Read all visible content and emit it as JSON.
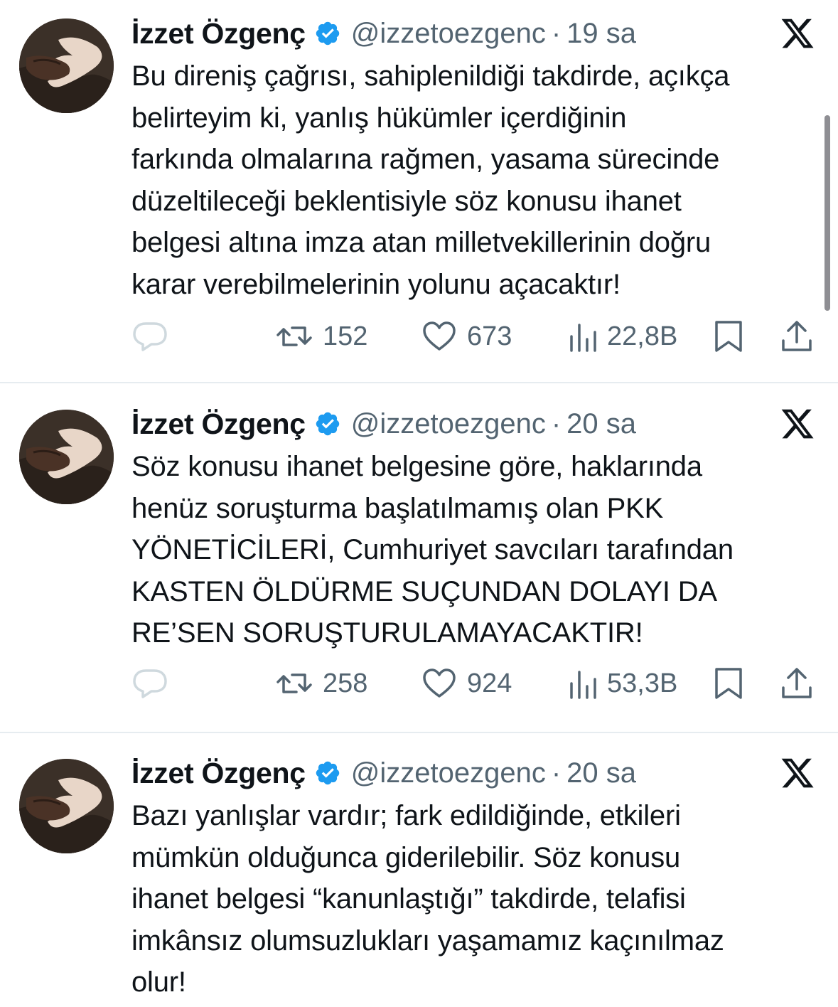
{
  "tweets": [
    {
      "name": "İzzet Özgenç",
      "handle": "@izzetoezgenc",
      "separator": "·",
      "time": "19 sa",
      "lines": [
        "Bu direniş çağrısı, sahiplenildiği takdirde, açıkça",
        "belirteyim ki, yanlış hükümler içerdiğinin",
        "farkında olmalarına rağmen, yasama sürecinde",
        "düzeltileceği beklentisiyle söz konusu ihanet",
        "belgesi altına imza atan milletvekillerinin doğru",
        "karar verebilmelerinin yolunu açacaktır!"
      ],
      "retweets": "152",
      "likes": "673",
      "views": "22,8B"
    },
    {
      "name": "İzzet Özgenç",
      "handle": "@izzetoezgenc",
      "separator": "·",
      "time": "20 sa",
      "lines": [
        "Söz konusu ihanet belgesine göre, haklarında",
        "henüz soruşturma başlatılmamış olan PKK",
        "YÖNETİCİLERİ, Cumhuriyet savcıları tarafından",
        "KASTEN ÖLDÜRME SUÇUNDAN DOLAYI DA",
        "RE’SEN SORUŞTURULAMAYACAKTIR!"
      ],
      "retweets": "258",
      "likes": "924",
      "views": "53,3B"
    },
    {
      "name": "İzzet Özgenç",
      "handle": "@izzetoezgenc",
      "separator": "·",
      "time": "20 sa",
      "lines": [
        "Bazı yanlışlar vardır; fark edildiğinde, etkileri",
        "mümkün olduğunca giderilebilir. Söz konusu",
        "ihanet belgesi “kanunlaştığı” takdirde, telafisi",
        "imkânsız olumsuzlukları yaşamamız kaçınılmaz",
        "olur!"
      ]
    }
  ],
  "icons": {
    "verified": "verified-badge-icon",
    "platform": "x-logo-icon",
    "reply": "reply-icon",
    "retweet": "retweet-icon",
    "like": "heart-icon",
    "views": "views-icon",
    "bookmark": "bookmark-icon",
    "share": "share-icon"
  },
  "colors": {
    "verified": "#1d9bf0",
    "secondary_text": "#536471",
    "divider": "#e6ecf0"
  }
}
